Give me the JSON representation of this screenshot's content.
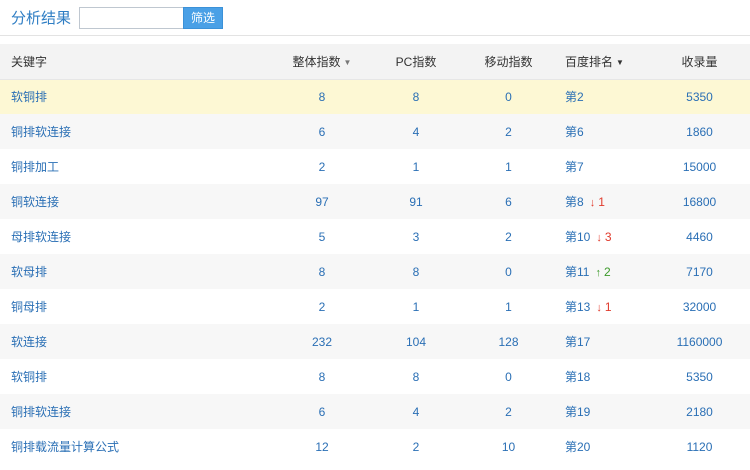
{
  "header": {
    "title": "分析结果",
    "search_value": "",
    "search_placeholder": "",
    "filter_label": "筛选"
  },
  "table": {
    "columns": {
      "keyword": "关键字",
      "overall_index": "整体指数",
      "pc_index": "PC指数",
      "mobile_index": "移动指数",
      "baidu_rank": "百度排名",
      "indexed_count": "收录量"
    },
    "rows": [
      {
        "keyword": "软铜排",
        "overall": "8",
        "pc": "8",
        "mobile": "0",
        "rank": "第2",
        "change": "",
        "change_dir": "",
        "indexed": "5350",
        "highlight": true
      },
      {
        "keyword": "铜排软连接",
        "overall": "6",
        "pc": "4",
        "mobile": "2",
        "rank": "第6",
        "change": "",
        "change_dir": "",
        "indexed": "1860"
      },
      {
        "keyword": "铜排加工",
        "overall": "2",
        "pc": "1",
        "mobile": "1",
        "rank": "第7",
        "change": "",
        "change_dir": "",
        "indexed": "15000"
      },
      {
        "keyword": "铜软连接",
        "overall": "97",
        "pc": "91",
        "mobile": "6",
        "rank": "第8",
        "change": "1",
        "change_dir": "down",
        "indexed": "16800"
      },
      {
        "keyword": "母排软连接",
        "overall": "5",
        "pc": "3",
        "mobile": "2",
        "rank": "第10",
        "change": "3",
        "change_dir": "down",
        "indexed": "4460"
      },
      {
        "keyword": "软母排",
        "overall": "8",
        "pc": "8",
        "mobile": "0",
        "rank": "第11",
        "change": "2",
        "change_dir": "up",
        "indexed": "7170"
      },
      {
        "keyword": "铜母排",
        "overall": "2",
        "pc": "1",
        "mobile": "1",
        "rank": "第13",
        "change": "1",
        "change_dir": "down",
        "indexed": "32000"
      },
      {
        "keyword": "软连接",
        "overall": "232",
        "pc": "104",
        "mobile": "128",
        "rank": "第17",
        "change": "",
        "change_dir": "",
        "indexed": "1160000"
      },
      {
        "keyword": "软铜排",
        "overall": "8",
        "pc": "8",
        "mobile": "0",
        "rank": "第18",
        "change": "",
        "change_dir": "",
        "indexed": "5350"
      },
      {
        "keyword": "铜排软连接",
        "overall": "6",
        "pc": "4",
        "mobile": "2",
        "rank": "第19",
        "change": "",
        "change_dir": "",
        "indexed": "2180"
      },
      {
        "keyword": "铜排载流量计算公式",
        "overall": "12",
        "pc": "2",
        "mobile": "10",
        "rank": "第20",
        "change": "",
        "change_dir": "",
        "indexed": "1120"
      }
    ]
  },
  "colors": {
    "accent": "#2f7ec4",
    "button": "#4aa0e6",
    "highlight_row": "#fdf8d4",
    "rank_down": "#e03a2c",
    "rank_up": "#3d9a2b"
  },
  "icons": {
    "sort": "caret-down-icon",
    "rank_down": "arrow-down-icon",
    "rank_up": "arrow-up-icon"
  }
}
